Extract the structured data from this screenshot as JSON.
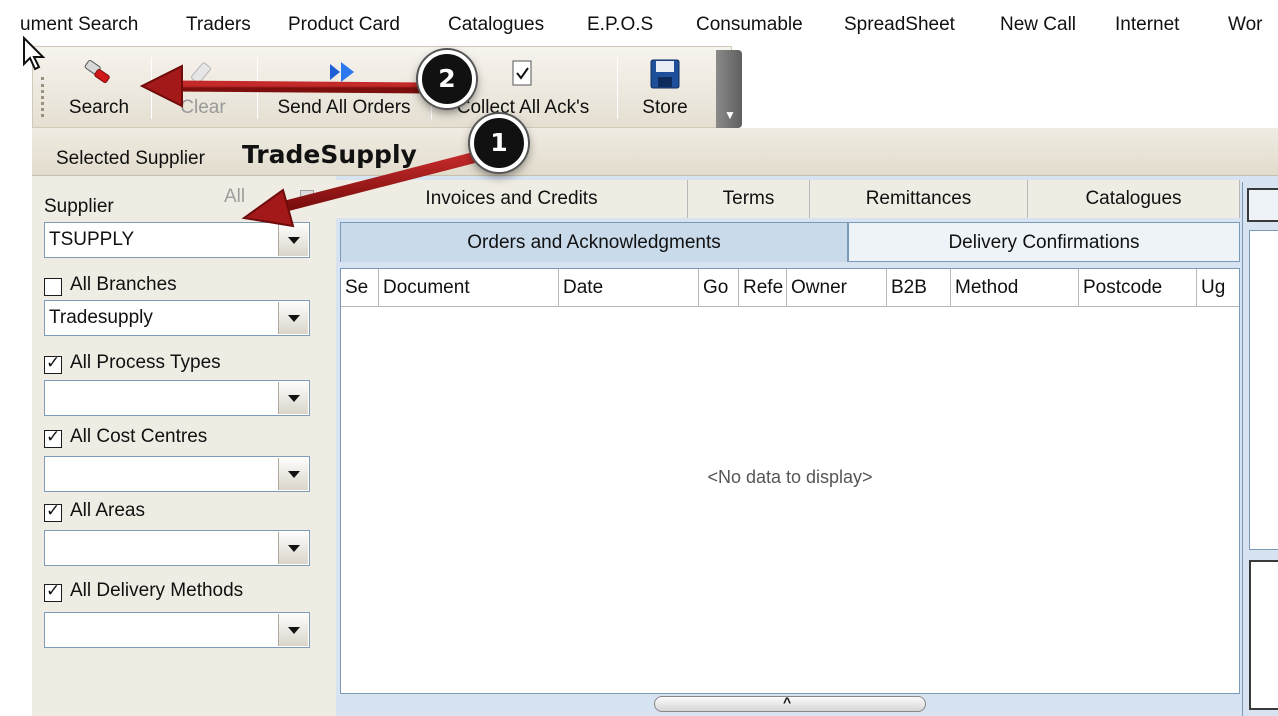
{
  "menu": {
    "items": [
      "ument Search",
      "Traders",
      "Product Card",
      "Catalogues",
      "E.P.O.S",
      "Consumable",
      "SpreadSheet",
      "New Call",
      "Internet",
      "Wor"
    ]
  },
  "toolbar": {
    "search_label": "Search",
    "clear_label": "Clear",
    "send_all_orders_label": "Send All Orders",
    "collect_all_acks_label": "Collect All Ack's",
    "store_label": "Store"
  },
  "selected_supplier": {
    "label": "Selected Supplier",
    "value": "TradeSupply"
  },
  "filters": {
    "supplier_label": "Supplier",
    "all_label": "All",
    "supplier_value": "TSUPPLY",
    "all_branches_label": "All Branches",
    "all_branches_checked": false,
    "branch_value": "Tradesupply",
    "all_process_types_label": "All Process Types",
    "all_process_types_checked": true,
    "process_type_value": "",
    "all_cost_centres_label": "All Cost Centres",
    "all_cost_centres_checked": true,
    "cost_centre_value": "",
    "all_areas_label": "All Areas",
    "all_areas_checked": true,
    "area_value": "",
    "all_delivery_methods_label": "All Delivery Methods",
    "all_delivery_methods_checked": true,
    "delivery_method_value": ""
  },
  "tabs": {
    "row1": [
      "Invoices and Credits",
      "Terms",
      "Remittances",
      "Catalogues"
    ],
    "row2_active": "Orders and Acknowledgments",
    "row2_inactive": "Delivery Confirmations"
  },
  "grid": {
    "columns": [
      "Se",
      "Document",
      "Date",
      "Go",
      "Refe",
      "Owner",
      "B2B",
      "Method",
      "Postcode",
      "Ug"
    ],
    "empty_message": "<No data to display>"
  },
  "annotations": {
    "badge1": "1",
    "badge2": "2",
    "arrow_color": "#a31818"
  }
}
